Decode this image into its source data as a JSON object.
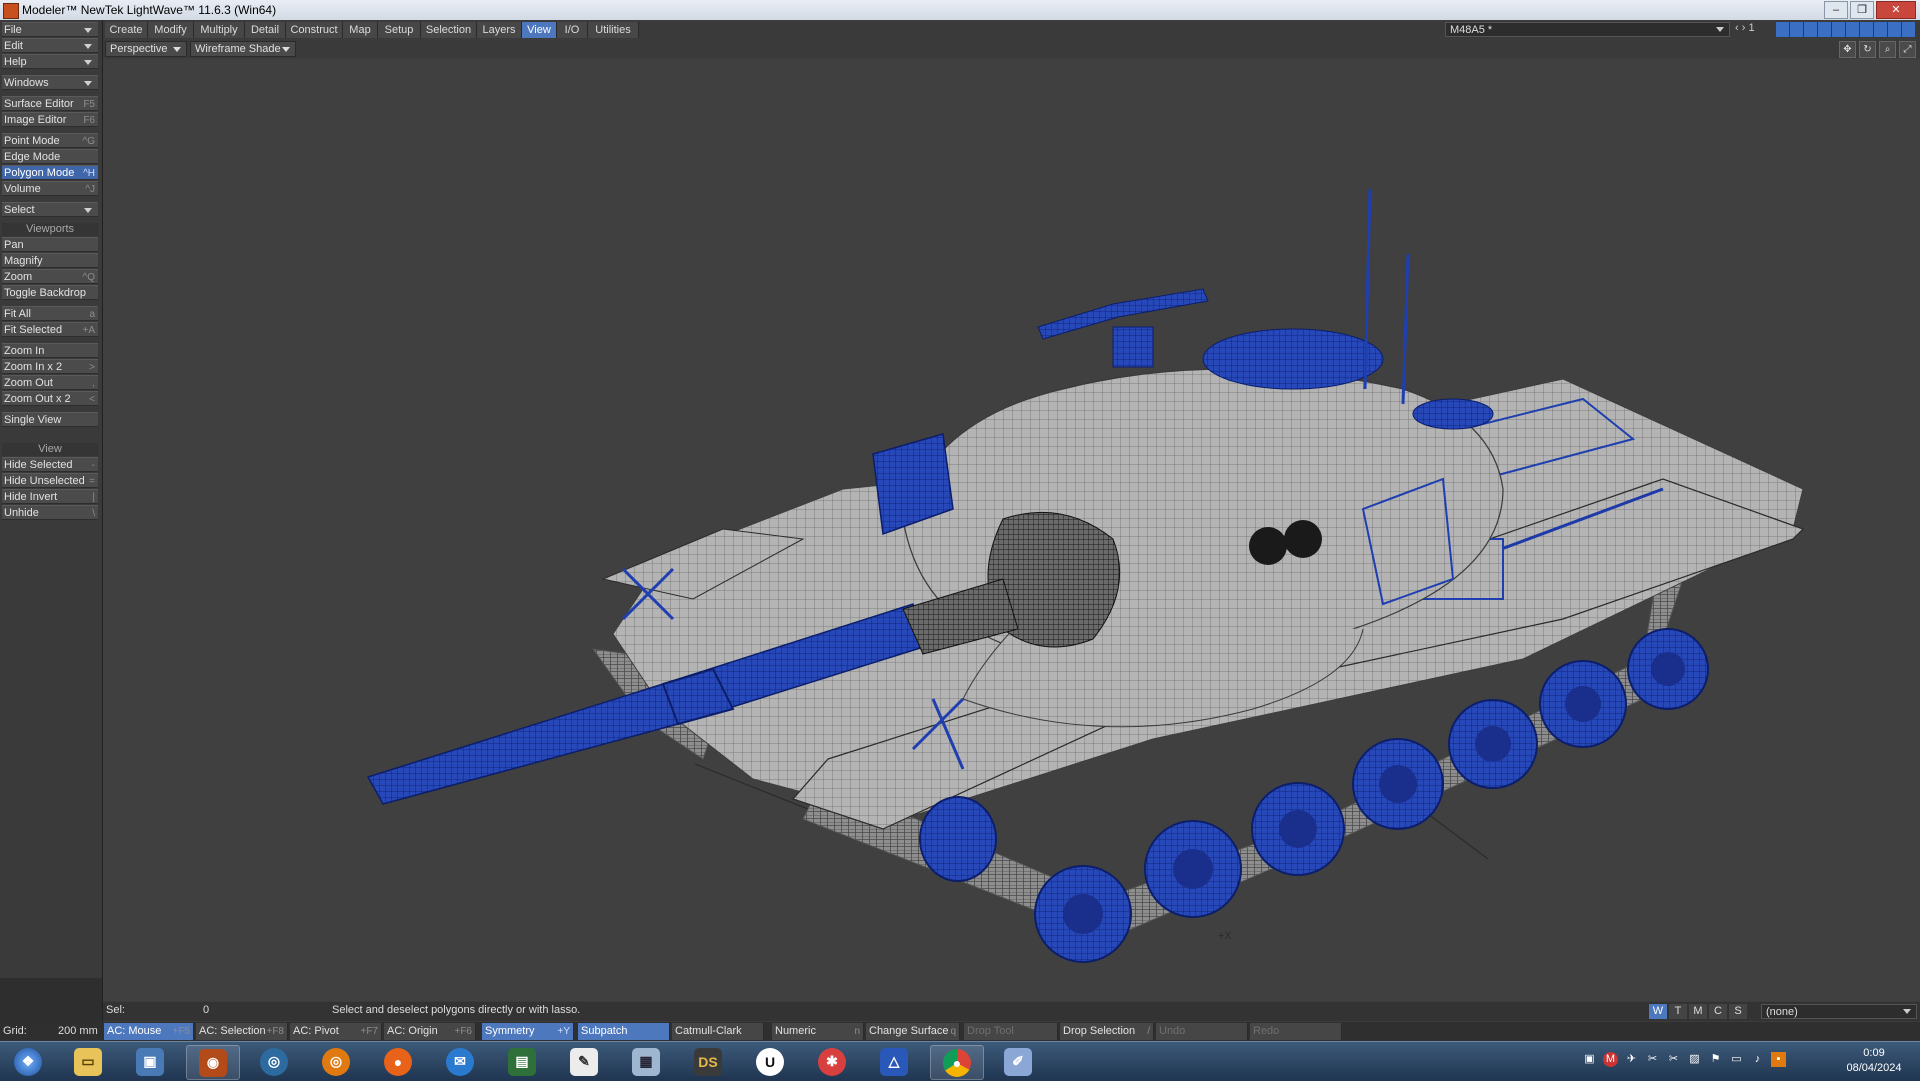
{
  "window": {
    "title": "Modeler™ NewTek LightWave™ 11.6.3 (Win64)",
    "controls": [
      "minimize-icon",
      "restore-icon",
      "close-icon"
    ]
  },
  "left_panel": {
    "file": "File",
    "edit": "Edit",
    "help": "Help",
    "windows": "Windows",
    "surface_editor": {
      "label": "Surface Editor",
      "shortcut": "F5"
    },
    "image_editor": {
      "label": "Image Editor",
      "shortcut": "F6"
    },
    "point_mode": {
      "label": "Point Mode",
      "shortcut": "^G"
    },
    "edge_mode": {
      "label": "Edge Mode",
      "shortcut": ""
    },
    "polygon_mode": {
      "label": "Polygon Mode",
      "shortcut": "^H"
    },
    "volume": {
      "label": "Volume",
      "shortcut": "^J"
    },
    "select": "Select",
    "viewports_header": "Viewports",
    "pan": {
      "label": "Pan",
      "shortcut": ""
    },
    "magnify": {
      "label": "Magnify",
      "shortcut": ""
    },
    "zoom": {
      "label": "Zoom",
      "shortcut": "^Q"
    },
    "toggle_backdrop": {
      "label": "Toggle Backdrop",
      "shortcut": ""
    },
    "fit_all": {
      "label": "Fit All",
      "shortcut": "a"
    },
    "fit_selected": {
      "label": "Fit Selected",
      "shortcut": "+A"
    },
    "zoom_in": {
      "label": "Zoom In",
      "shortcut": ""
    },
    "zoom_in_x2": {
      "label": "Zoom In x 2",
      "shortcut": ">"
    },
    "zoom_out": {
      "label": "Zoom Out",
      "shortcut": ","
    },
    "zoom_out_x2": {
      "label": "Zoom Out x 2",
      "shortcut": "<"
    },
    "single_view": {
      "label": "Single View",
      "shortcut": ""
    },
    "view_header": "View",
    "hide_selected": {
      "label": "Hide Selected",
      "shortcut": "-"
    },
    "hide_unselected": {
      "label": "Hide Unselected",
      "shortcut": "="
    },
    "hide_invert": {
      "label": "Hide Invert",
      "shortcut": "|"
    },
    "unhide": {
      "label": "Unhide",
      "shortcut": "\\"
    }
  },
  "menu_tabs": [
    "Create",
    "Modify",
    "Multiply",
    "Detail",
    "Construct",
    "Map",
    "Setup",
    "Selection",
    "Layers",
    "View",
    "I/O",
    "Utilities"
  ],
  "active_tab": "View",
  "layer": {
    "name": "M48A5 *",
    "current_layer": "1"
  },
  "viewport": {
    "projection": "Perspective",
    "shading": "Wireframe Shade",
    "axis_label": "+X"
  },
  "status": {
    "sel_label": "Sel:",
    "sel_value": "0",
    "hint": "Select and deselect polygons directly or with lasso.",
    "wtmcs": [
      "W",
      "T",
      "M",
      "C",
      "S"
    ],
    "surface": "(none)"
  },
  "toolbar": {
    "grid_label": "Grid:",
    "grid_value": "200 mm",
    "buttons": [
      {
        "label": "AC: Mouse",
        "shortcut": "+F5"
      },
      {
        "label": "AC: Selection",
        "shortcut": "+F8"
      },
      {
        "label": "AC: Pivot",
        "shortcut": "+F7"
      },
      {
        "label": "AC: Origin",
        "shortcut": "+F6"
      },
      {
        "label": "Symmetry",
        "shortcut": "+Y"
      },
      {
        "label": "Subpatch",
        "shortcut": ""
      },
      {
        "label": "Catmull-Clark",
        "shortcut": ""
      },
      {
        "label": "Numeric",
        "shortcut": "n"
      },
      {
        "label": "Change Surface",
        "shortcut": "q"
      },
      {
        "label": "Drop Tool",
        "shortcut": ""
      },
      {
        "label": "Drop Selection",
        "shortcut": "/"
      },
      {
        "label": "Undo",
        "shortcut": ""
      },
      {
        "label": "Redo",
        "shortcut": ""
      }
    ]
  },
  "taskbar": {
    "apps": [
      "start-orb-icon",
      "file-explorer-icon",
      "photo-viewer-icon",
      "lightwave-icon",
      "blender-icon",
      "blender-icon",
      "firefox-icon",
      "thunderbird-icon",
      "terminal-icon",
      "notepad-icon",
      "calculator-icon",
      "daz-studio-icon",
      "unreal-icon",
      "app-icon",
      "affinity-icon",
      "chrome-icon",
      "paint-icon"
    ],
    "ds_label": "DS",
    "u_label": "U",
    "time": "0:09",
    "date": "08/04/2024"
  },
  "colors": {
    "accent_blue": "#4e78bd",
    "wire_blue": "#1f3fb0",
    "mesh_grey": "#a8a8a8"
  }
}
